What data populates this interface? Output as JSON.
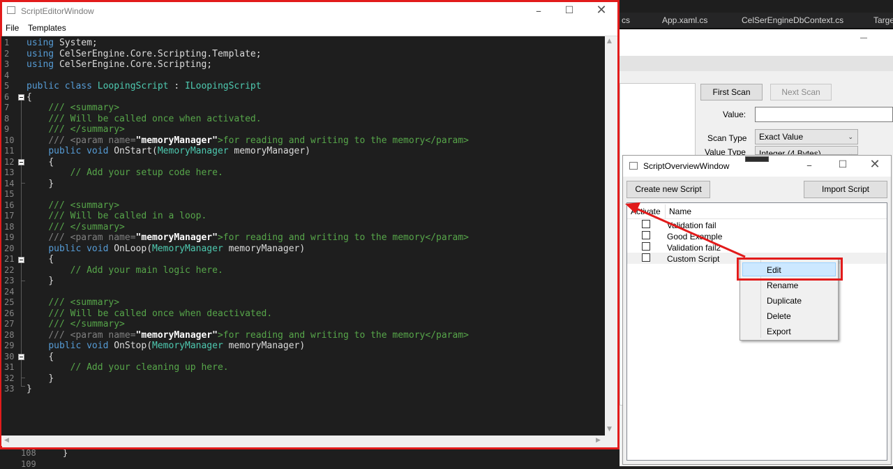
{
  "ide": {
    "tabs": [
      "cs",
      "App.xaml.cs",
      "CelSerEngineDbContext.cs",
      "Targe"
    ],
    "bg_lines": [
      {
        "num": "108",
        "code": "}"
      },
      {
        "num": "109",
        "code": ""
      }
    ]
  },
  "app": {
    "first_scan": "First Scan",
    "next_scan": "Next Scan",
    "value_label": "Value:",
    "scan_type_label": "Scan Type",
    "scan_type_value": "Exact Value",
    "value_type_label": "Value Type",
    "value_type_value": "Integer (4 Bytes)"
  },
  "editor": {
    "title": "ScriptEditorWindow",
    "menu": [
      "File",
      "Templates"
    ],
    "lines": [
      "1",
      "2",
      "3",
      "4",
      "5",
      "6",
      "7",
      "8",
      "9",
      "10",
      "11",
      "12",
      "13",
      "14",
      "15",
      "16",
      "17",
      "18",
      "19",
      "20",
      "21",
      "22",
      "23",
      "24",
      "25",
      "26",
      "27",
      "28",
      "29",
      "30",
      "31",
      "32",
      "33"
    ],
    "code": {
      "l1_kw": "using",
      "l1_rest": " System;",
      "l2_kw": "using",
      "l2_rest": " CelSerEngine.Core.Scripting.Template;",
      "l3_kw": "using",
      "l3_rest": " CelSerEngine.Core.Scripting;",
      "l5_kw": "public class",
      "l5_type": "LoopingScript",
      "l5_colon": " : ",
      "l5_iface": "ILoopingScript",
      "open": "{",
      "close": "}",
      "sum_open": "/// <summary>",
      "sum_close": "/// </summary>",
      "c_start": "/// Will be called once when activated.",
      "c_loop": "/// Will be called in a loop.",
      "c_stop": "/// Will be called once when deactivated.",
      "param_pre": "/// <param name=",
      "param_name": "\"memoryManager\"",
      "param_post": ">for reading and writing to the memory</param>",
      "pv": "public void",
      "m_start": "OnStart(",
      "m_loop": "OnLoop(",
      "m_stop": "OnStop(",
      "mm_type": "MemoryManager",
      "mm_arg": " memoryManager)",
      "setup": "// Add your setup code here.",
      "main": "// Add your main logic here.",
      "clean": "// Add your cleaning up here."
    }
  },
  "overview": {
    "title": "ScriptOverviewWindow",
    "create_btn": "Create new Script",
    "import_btn": "Import Script",
    "col_activate": "Activate",
    "col_name": "Name",
    "rows": [
      "Validation fail",
      "Good Example",
      "Validation fail2",
      "Custom Script"
    ]
  },
  "context_menu": {
    "items": [
      "Edit",
      "Rename",
      "Duplicate",
      "Delete",
      "Export"
    ]
  },
  "colors": {
    "annotation_red": "#e21b1b",
    "highlight": "#cce8ff"
  }
}
